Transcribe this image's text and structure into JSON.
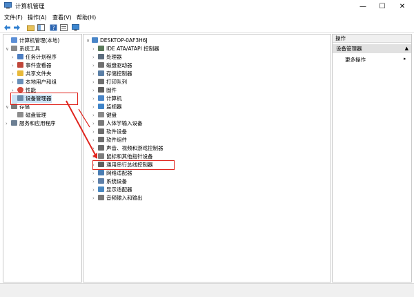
{
  "window": {
    "title": "计算机管理",
    "minimize": "—",
    "maximize": "☐",
    "close": "✕"
  },
  "menu": [
    "文件(F)",
    "操作(A)",
    "查看(V)",
    "帮助(H)"
  ],
  "left_tree": [
    {
      "label": "计算机管理(本地)",
      "expand": "",
      "indent": 0,
      "icon": "computer-icon",
      "color": "#5c8fd6"
    },
    {
      "label": "系统工具",
      "expand": "∨",
      "indent": 1,
      "icon": "tools-icon",
      "color": "#8a8a8a"
    },
    {
      "label": "任务计划程序",
      "expand": "›",
      "indent": 2,
      "icon": "clock-icon",
      "color": "#4d7ec2"
    },
    {
      "label": "事件查看器",
      "expand": "›",
      "indent": 2,
      "icon": "event-icon",
      "color": "#c0463a"
    },
    {
      "label": "共享文件夹",
      "expand": "›",
      "indent": 2,
      "icon": "folder-icon",
      "color": "#e8b93a"
    },
    {
      "label": "本地用户和组",
      "expand": "›",
      "indent": 2,
      "icon": "users-icon",
      "color": "#6a8fb8"
    },
    {
      "label": "性能",
      "expand": "›",
      "indent": 2,
      "icon": "performance-icon",
      "color": "#d14a3c"
    },
    {
      "label": "设备管理器",
      "expand": "",
      "indent": 2,
      "icon": "device-manager-icon",
      "color": "#6b8aa8"
    },
    {
      "label": "存储",
      "expand": "∨",
      "indent": 0,
      "icon": "storage-icon",
      "color": "#7b7b7b"
    },
    {
      "label": "磁盘管理",
      "expand": "",
      "indent": 1,
      "icon": "disk-icon",
      "color": "#8d8d8d"
    },
    {
      "label": "服务和应用程序",
      "expand": "›",
      "indent": 0,
      "icon": "services-icon",
      "color": "#6c7f93"
    }
  ],
  "device_tree": {
    "root": "DESKTOP-0AF3H6J",
    "items": [
      {
        "label": "IDE ATA/ATAPI 控制器",
        "icon": "ide-icon",
        "color": "#5a7a5a"
      },
      {
        "label": "处理器",
        "icon": "cpu-icon",
        "color": "#5d6d7e"
      },
      {
        "label": "磁盘驱动器",
        "icon": "disk-drive-icon",
        "color": "#707070"
      },
      {
        "label": "存储控制器",
        "icon": "storage-controller-icon",
        "color": "#5b7fa6"
      },
      {
        "label": "打印队列",
        "icon": "printer-icon",
        "color": "#6f6f6f"
      },
      {
        "label": "固件",
        "icon": "firmware-icon",
        "color": "#5f5f5f"
      },
      {
        "label": "计算机",
        "icon": "computer-icon",
        "color": "#4a86c8"
      },
      {
        "label": "监视器",
        "icon": "monitor-icon",
        "color": "#3f84c8"
      },
      {
        "label": "键盘",
        "icon": "keyboard-icon",
        "color": "#8a8a8a"
      },
      {
        "label": "人体学输入设备",
        "icon": "hid-icon",
        "color": "#7a7a7a"
      },
      {
        "label": "软件设备",
        "icon": "software-device-icon",
        "color": "#6d6d6d"
      },
      {
        "label": "软件组件",
        "icon": "software-component-icon",
        "color": "#6d6d6d"
      },
      {
        "label": "声音、视频和游戏控制器",
        "icon": "sound-icon",
        "color": "#6a6a6a"
      },
      {
        "label": "鼠标和其他指针设备",
        "icon": "mouse-icon",
        "color": "#7d7d7d"
      },
      {
        "label": "通用串行总线控制器",
        "icon": "usb-icon",
        "color": "#5e5e5e"
      },
      {
        "label": "网络适配器",
        "icon": "network-icon",
        "color": "#4b7db3"
      },
      {
        "label": "系统设备",
        "icon": "system-device-icon",
        "color": "#5f80a8"
      },
      {
        "label": "显示适配器",
        "icon": "display-adapter-icon",
        "color": "#4a88c0"
      },
      {
        "label": "音频输入和输出",
        "icon": "audio-icon",
        "color": "#777777"
      }
    ]
  },
  "actions": {
    "header": "操作",
    "selected": "设备管理器",
    "more": "更多操作",
    "arrow_up": "▲",
    "arrow_right": "▸"
  },
  "annotation_color": "#e0241d"
}
